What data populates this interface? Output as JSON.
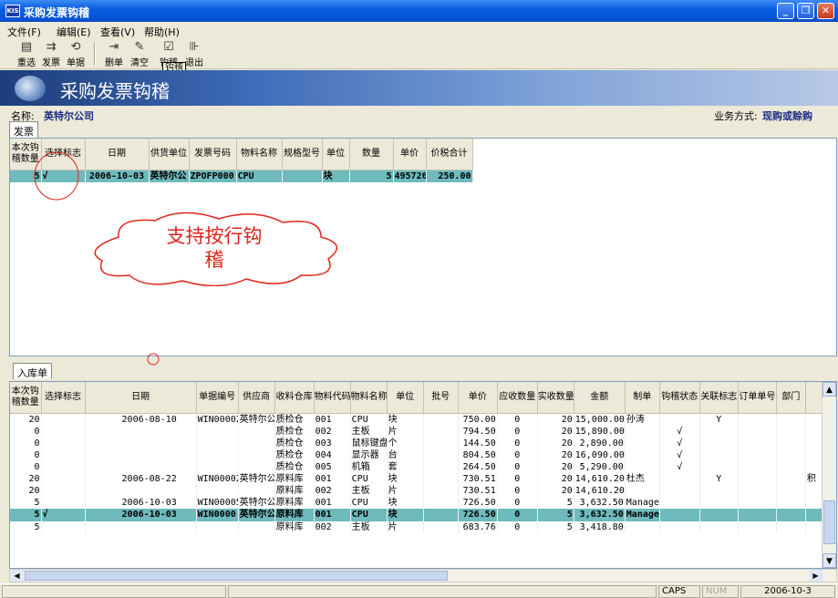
{
  "window": {
    "title": "采购发票钩稽",
    "app_icon": "KIS"
  },
  "menu": [
    "文件(F)",
    "编辑(E)",
    "查看(V)",
    "帮助(H)"
  ],
  "toolbar": {
    "buttons": [
      "重选",
      "发票",
      "单据",
      "删单",
      "清空",
      "钩稽",
      "退出"
    ],
    "tooltip": "钩稽"
  },
  "banner": {
    "title": "采购发票钩稽"
  },
  "info": {
    "name_label": "名称:",
    "name_value": "英特尔公司",
    "mode_label": "业务方式:",
    "mode_value": "现购或赊购"
  },
  "invoice": {
    "tab": "发票",
    "columns": [
      "本次钩稽数量",
      "选择标志",
      "日期",
      "供货单位",
      "发票号码",
      "物料名称",
      "规格型号",
      "单位",
      "数量",
      "单价",
      "价税合计"
    ],
    "rows": [
      {
        "qty": "5",
        "flag": "√",
        "date": "2006-10-03",
        "supplier": "英特尔公",
        "no": "ZPOFP000",
        "item": "CPU",
        "spec": "",
        "unit": "块",
        "count": "5",
        "price": "495726",
        "total": "250.00"
      }
    ]
  },
  "annotation": {
    "line1": "支持按行钩",
    "line2": "稽"
  },
  "receipt": {
    "tab": "入库单",
    "columns": [
      "本次钩稽数量",
      "选择标志",
      "日期",
      "单据编号",
      "供应商",
      "收料仓库",
      "物料代码",
      "物料名称",
      "单位",
      "批号",
      "单价",
      "应收数量",
      "实收数量",
      "金额",
      "制单",
      "钩稽状态",
      "关联标志",
      "订单单号",
      "部门",
      ""
    ],
    "rows": [
      {
        "qty": "20",
        "flag": "",
        "date": "2006-08-10",
        "no": "WIN00002",
        "sup": "英特尔公",
        "wh": "质检仓",
        "code": "001",
        "name": "CPU",
        "unit": "块",
        "lot": "",
        "price": "750.00",
        "due": "0",
        "act": "20",
        "amt": "15,000.00",
        "maker": "孙涛",
        "st": "",
        "link": "Y",
        "ord": "",
        "dept": "",
        "x": ""
      },
      {
        "qty": "0",
        "flag": "",
        "date": "",
        "no": "",
        "sup": "",
        "wh": "质检仓",
        "code": "002",
        "name": "主板",
        "unit": "片",
        "lot": "",
        "price": "794.50",
        "due": "0",
        "act": "20",
        "amt": "15,890.00",
        "maker": "",
        "st": "√",
        "link": "",
        "ord": "",
        "dept": "",
        "x": ""
      },
      {
        "qty": "0",
        "flag": "",
        "date": "",
        "no": "",
        "sup": "",
        "wh": "质检仓",
        "code": "003",
        "name": "鼠标键盘",
        "unit": "个",
        "lot": "",
        "price": "144.50",
        "due": "0",
        "act": "20",
        "amt": "2,890.00",
        "maker": "",
        "st": "√",
        "link": "",
        "ord": "",
        "dept": "",
        "x": ""
      },
      {
        "qty": "0",
        "flag": "",
        "date": "",
        "no": "",
        "sup": "",
        "wh": "质检仓",
        "code": "004",
        "name": "显示器",
        "unit": "台",
        "lot": "",
        "price": "804.50",
        "due": "0",
        "act": "20",
        "amt": "16,090.00",
        "maker": "",
        "st": "√",
        "link": "",
        "ord": "",
        "dept": "",
        "x": ""
      },
      {
        "qty": "0",
        "flag": "",
        "date": "",
        "no": "",
        "sup": "",
        "wh": "质检仓",
        "code": "005",
        "name": "机箱",
        "unit": "套",
        "lot": "",
        "price": "264.50",
        "due": "0",
        "act": "20",
        "amt": "5,290.00",
        "maker": "",
        "st": "√",
        "link": "",
        "ord": "",
        "dept": "",
        "x": ""
      },
      {
        "qty": "20",
        "flag": "",
        "date": "2006-08-22",
        "no": "WIN00002",
        "sup": "英特尔公",
        "wh": "原料库",
        "code": "001",
        "name": "CPU",
        "unit": "块",
        "lot": "",
        "price": "730.51",
        "due": "0",
        "act": "20",
        "amt": "14,610.20",
        "maker": "杜杰",
        "st": "",
        "link": "Y",
        "ord": "",
        "dept": "",
        "x": "积"
      },
      {
        "qty": "20",
        "flag": "",
        "date": "",
        "no": "",
        "sup": "",
        "wh": "原料库",
        "code": "002",
        "name": "主板",
        "unit": "片",
        "lot": "",
        "price": "730.51",
        "due": "0",
        "act": "20",
        "amt": "14,610.20",
        "maker": "",
        "st": "",
        "link": "",
        "ord": "",
        "dept": "",
        "x": ""
      },
      {
        "qty": "5",
        "flag": "",
        "date": "2006-10-03",
        "no": "WIN00005",
        "sup": "英特尔公",
        "wh": "原料库",
        "code": "001",
        "name": "CPU",
        "unit": "块",
        "lot": "",
        "price": "726.50",
        "due": "0",
        "act": "5",
        "amt": "3,632.50",
        "maker": "Manager",
        "st": "",
        "link": "",
        "ord": "",
        "dept": "",
        "x": ""
      },
      {
        "qty": "5",
        "flag": "√",
        "date": "2006-10-03",
        "no": "WIN0000",
        "sup": "英特尔公",
        "wh": "原料库",
        "code": "001",
        "name": "CPU",
        "unit": "块",
        "lot": "",
        "price": "726.50",
        "due": "0",
        "act": "5",
        "amt": "3,632.50",
        "maker": "Manager",
        "st": "",
        "link": "",
        "ord": "",
        "dept": "",
        "x": ""
      },
      {
        "qty": "5",
        "flag": "",
        "date": "",
        "no": "",
        "sup": "",
        "wh": "原料库",
        "code": "002",
        "name": "主板",
        "unit": "片",
        "lot": "",
        "price": "683.76",
        "due": "0",
        "act": "5",
        "amt": "3,418.80",
        "maker": "",
        "st": "",
        "link": "",
        "ord": "",
        "dept": "",
        "x": ""
      }
    ],
    "selected_row": 8
  },
  "status": {
    "caps": "CAPS",
    "num": "NUM",
    "date": "2006-10-3"
  }
}
